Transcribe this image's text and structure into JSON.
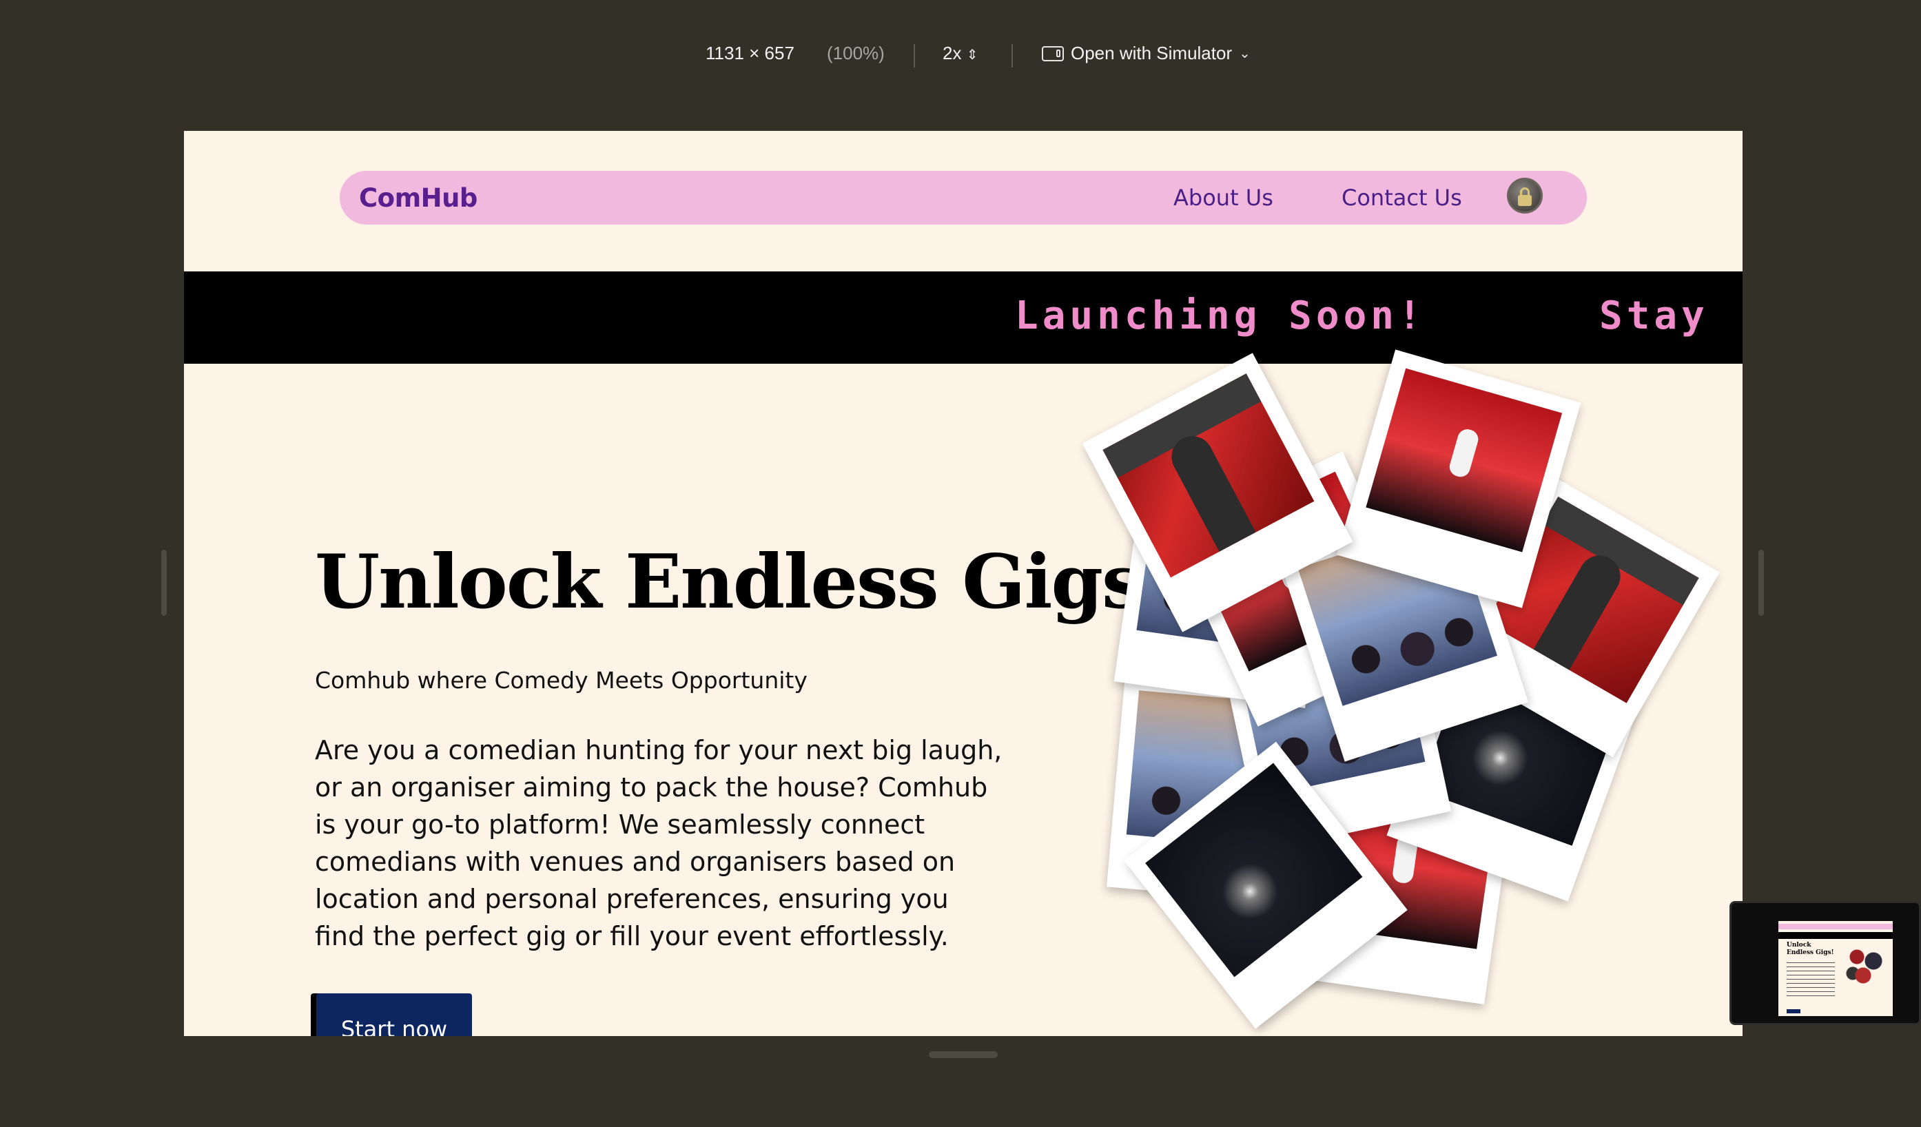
{
  "devtools": {
    "dimensions": "1131  ×  657",
    "zoom": "(100%)",
    "dpr": "2x",
    "simulator_label": "Open with Simulator"
  },
  "nav": {
    "brand": "ComHub",
    "links": [
      "About Us",
      "Contact Us"
    ]
  },
  "marquee": {
    "text": "Launching Soon!",
    "text_next": "Stay"
  },
  "hero": {
    "title": "Unlock Endless Gigs!",
    "subtitle": "Comhub where Comedy Meets Opportunity",
    "body": "Are you a comedian hunting for your next big laugh, or an organiser aiming to pack the house? Comhub is your go-to platform! We seamlessly connect comedians with venues and organisers based on location and personal preferences, ensuring you find the perfect gig or fill your event effortlessly.",
    "cta": "Start now"
  },
  "colors": {
    "page_bg": "#fdf3e7",
    "nav_bg": "#f1b9dd",
    "brand": "#5a1f8f",
    "marquee_bg": "#000000",
    "marquee_text": "#f08cc9",
    "cta_bg": "#0e2660"
  }
}
